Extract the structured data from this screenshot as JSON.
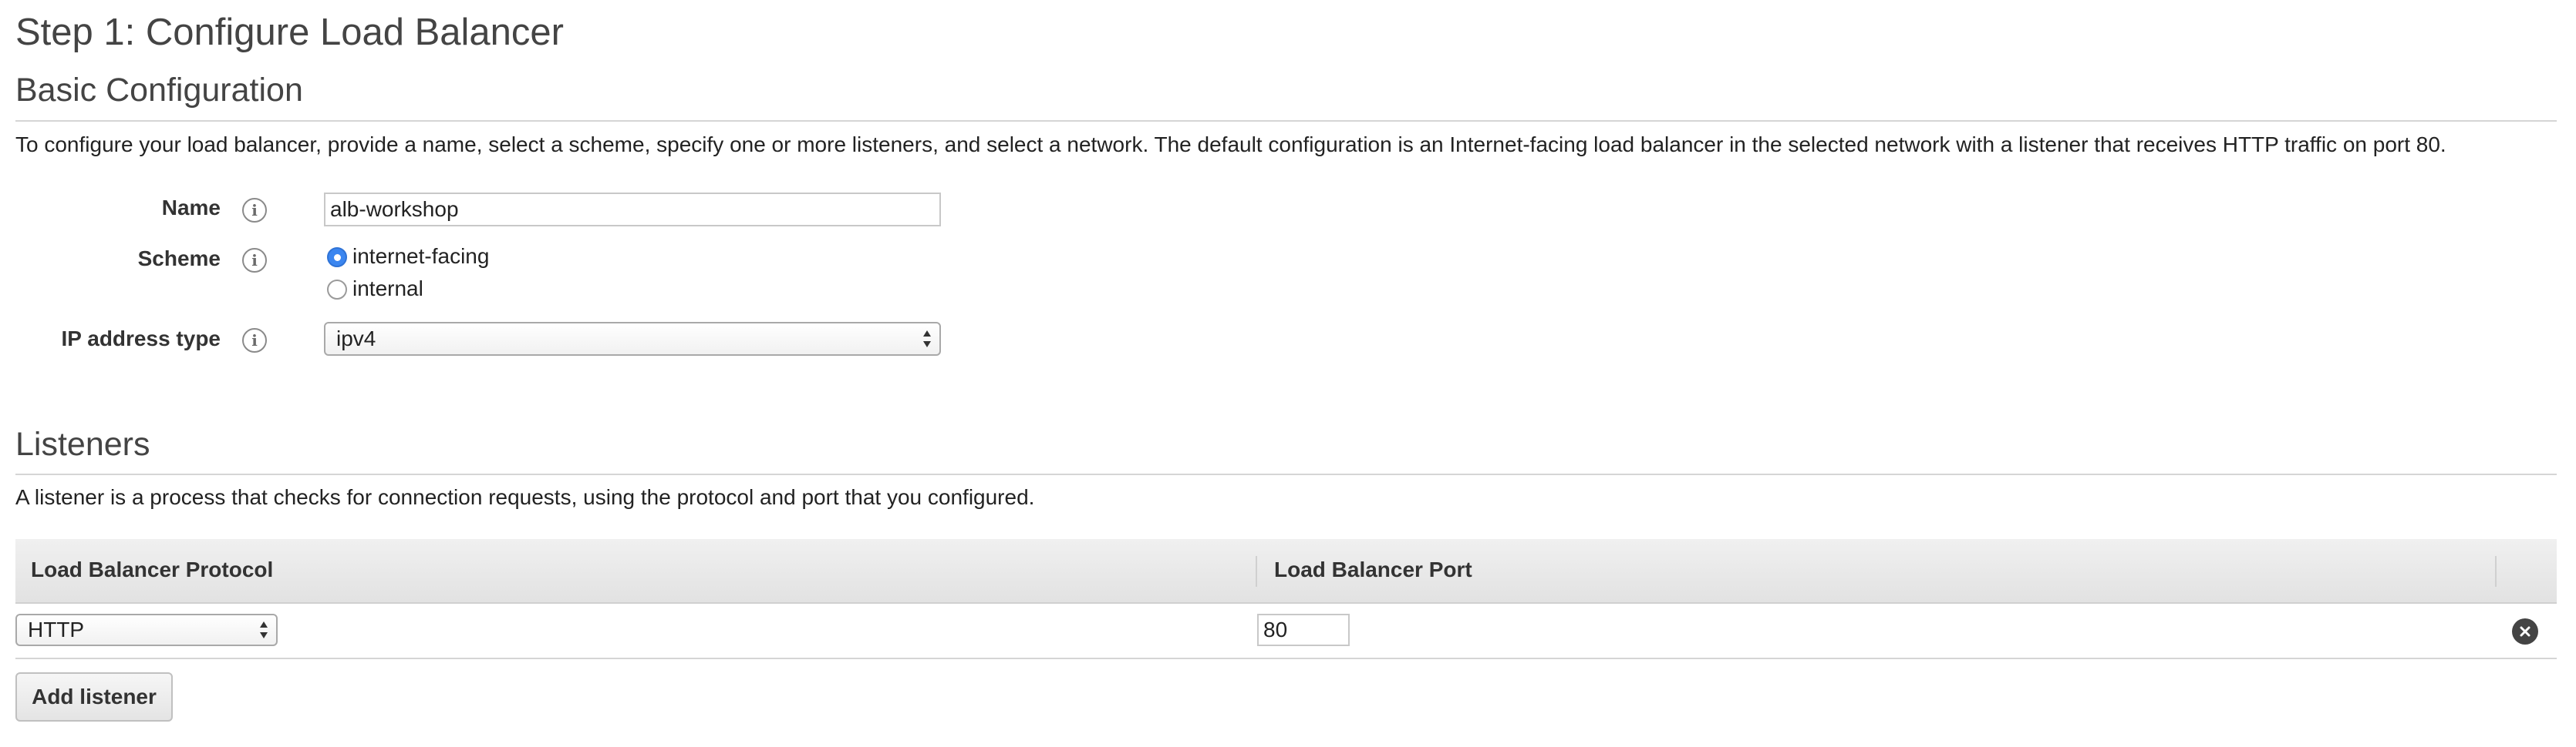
{
  "page": {
    "title": "Step 1: Configure Load Balancer"
  },
  "basic": {
    "heading": "Basic Configuration",
    "description": "To configure your load balancer, provide a name, select a scheme, specify one or more listeners, and select a network. The default configuration is an Internet-facing load balancer in the selected network with a listener that receives HTTP traffic on port 80.",
    "name_label": "Name",
    "name_value": "alb-workshop",
    "scheme_label": "Scheme",
    "scheme_options": [
      "internet-facing",
      "internal"
    ],
    "scheme_selected": "internet-facing",
    "ip_label": "IP address type",
    "ip_value": "ipv4"
  },
  "listeners": {
    "heading": "Listeners",
    "description": "A listener is a process that checks for connection requests, using the protocol and port that you configured.",
    "col_protocol": "Load Balancer Protocol",
    "col_port": "Load Balancer Port",
    "rows": [
      {
        "protocol": "HTTP",
        "port": "80"
      }
    ],
    "add_label": "Add listener"
  },
  "colors": {
    "radio_accent": "#3b86f0",
    "header_bg": "#e8e8e8",
    "text": "#222222",
    "heading": "#444444"
  },
  "icons": [
    "info-icon",
    "select-arrows-icon",
    "remove-icon"
  ]
}
